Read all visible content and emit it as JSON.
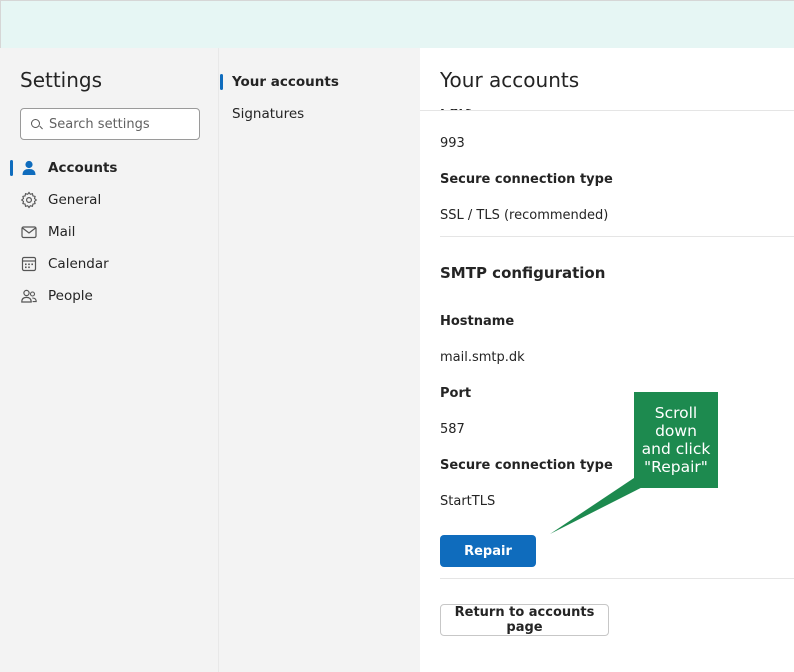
{
  "settings": {
    "title": "Settings",
    "search_placeholder": "Search settings"
  },
  "nav": {
    "items": [
      {
        "label": "Accounts",
        "icon": "person-icon",
        "active": true
      },
      {
        "label": "General",
        "icon": "gear-icon",
        "active": false
      },
      {
        "label": "Mail",
        "icon": "mail-icon",
        "active": false
      },
      {
        "label": "Calendar",
        "icon": "calendar-icon",
        "active": false
      },
      {
        "label": "People",
        "icon": "people-icon",
        "active": false
      }
    ]
  },
  "subnav": {
    "items": [
      {
        "label": "Your accounts",
        "active": true
      },
      {
        "label": "Signatures",
        "active": false
      }
    ]
  },
  "panel": {
    "title": "Your accounts",
    "cut_label": "Port",
    "imap_port": "993",
    "imap_secure_label": "Secure connection type",
    "imap_secure_value": "SSL / TLS (recommended)",
    "smtp_heading": "SMTP configuration",
    "smtp_hostname_label": "Hostname",
    "smtp_hostname_value": "mail.smtp.dk",
    "smtp_port_label": "Port",
    "smtp_port_value": "587",
    "smtp_secure_label": "Secure connection type",
    "smtp_secure_value": "StartTLS",
    "repair_label": "Repair",
    "return_label": "Return to accounts page"
  },
  "callout": {
    "lines": [
      "Scroll",
      "down",
      "and click",
      "\"Repair\""
    ],
    "color": "#1d8a4f"
  },
  "colors": {
    "accent": "#0f6cbd",
    "topbar": "#e6f6f4"
  }
}
